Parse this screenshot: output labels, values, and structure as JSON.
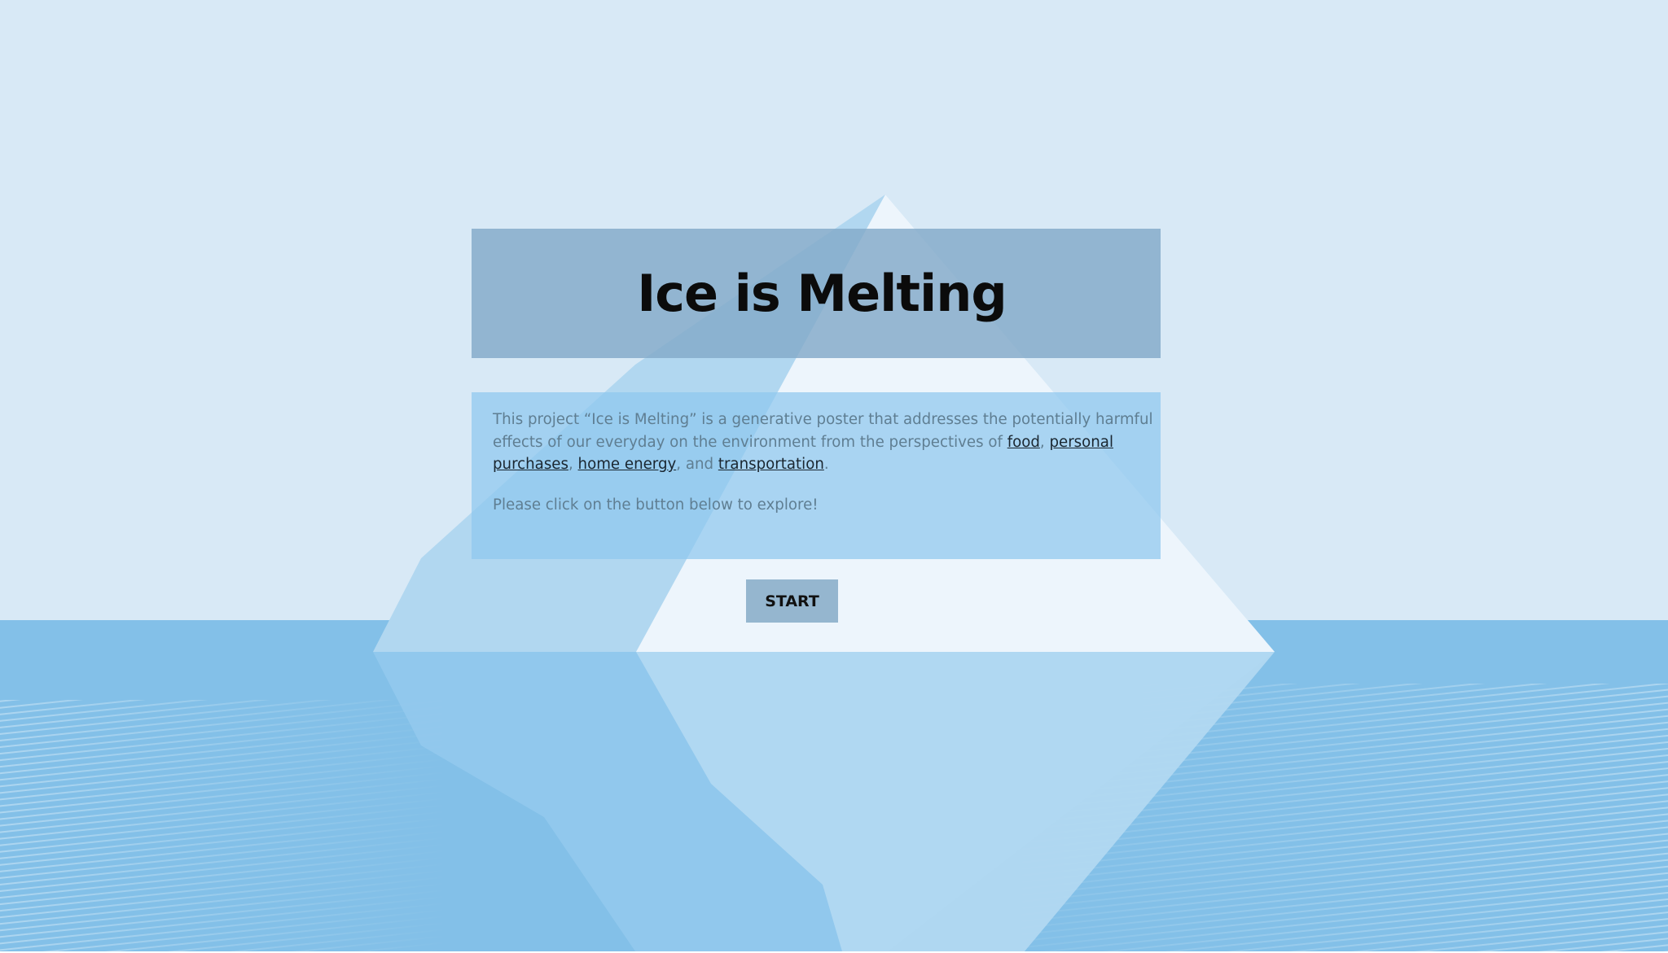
{
  "hero": {
    "title": "Ice is Melting"
  },
  "description": {
    "intro": "This project “Ice is Melting” is a generative poster that addresses the potentially harmful effects of our everyday on the environment from the perspectives of ",
    "links": {
      "food": "food",
      "personal_purchases": "personal purchases",
      "home_energy": "home energy",
      "transportation": "transportation"
    },
    "sep1": ", ",
    "sep2": ", ",
    "sep3": ", and ",
    "end": ".",
    "prompt": "Please click on the button below to explore!"
  },
  "start_button": {
    "label": "START"
  },
  "colors": {
    "sky": "#d8e9f6",
    "sea": "#83c0e8",
    "iceberg_light": "#edf5fc",
    "iceberg_mid": "#b1d7f0",
    "title_panel": "#82aac8",
    "desc_panel": "#8fc7ee",
    "button": "#95b6cf",
    "text_dark": "#0b0b0b",
    "text_muted": "#5f7e92"
  }
}
